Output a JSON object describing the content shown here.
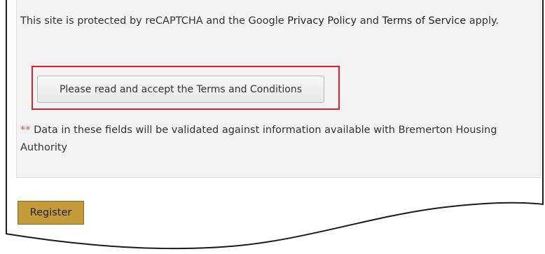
{
  "recaptcha": {
    "prefix": "This site is protected by reCAPTCHA and the Google ",
    "privacy_link": "Privacy Policy",
    "middle": " and ",
    "terms_link": "Terms of Service",
    "suffix": " apply."
  },
  "terms_button": {
    "label": "Please read and accept the Terms and Conditions"
  },
  "validation_note": {
    "marker": "**",
    "text": " Data in these fields will be validated against information available with Bremerton Housing Authority"
  },
  "register_button": {
    "label": "Register"
  },
  "colors": {
    "highlight": "#e0202a",
    "register_bg": "#c49a3a",
    "required_marker": "#d9534f"
  }
}
